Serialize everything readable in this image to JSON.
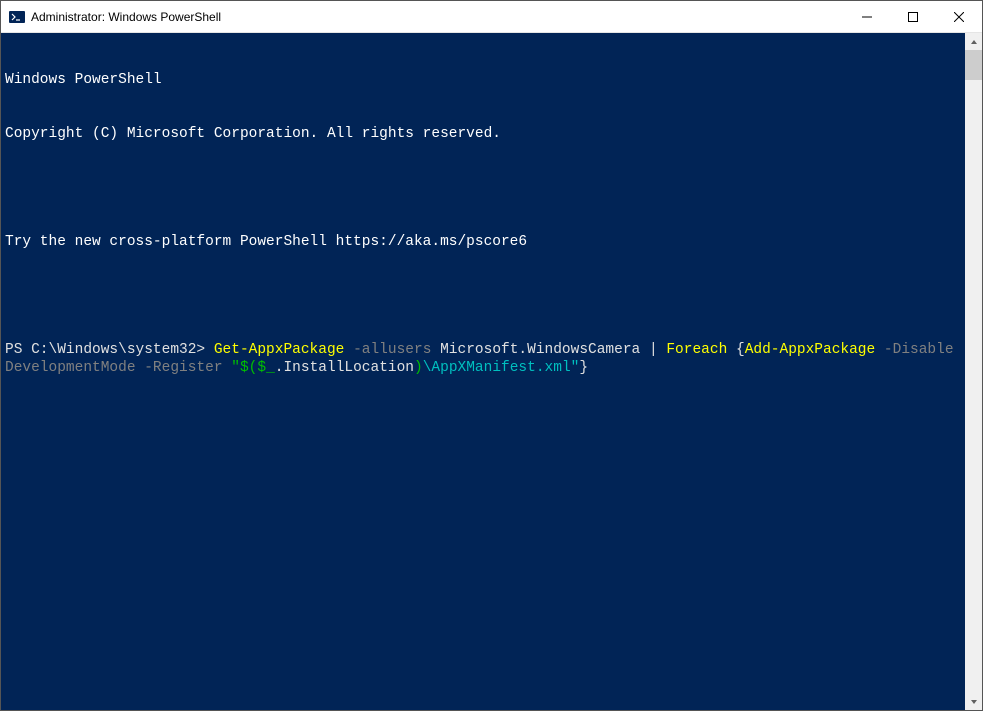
{
  "window": {
    "title": "Administrator: Windows PowerShell"
  },
  "console": {
    "banner_line1": "Windows PowerShell",
    "banner_line2": "Copyright (C) Microsoft Corporation. All rights reserved.",
    "hint": "Try the new cross-platform PowerShell https://aka.ms/pscore6",
    "prompt_prefix": "PS C:\\Windows\\system32> ",
    "command": {
      "tokens": [
        {
          "text": "Get-AppxPackage",
          "type": "cmd"
        },
        {
          "text": " ",
          "type": "white"
        },
        {
          "text": "-allusers",
          "type": "param"
        },
        {
          "text": " Microsoft.WindowsCamera ",
          "type": "white"
        },
        {
          "text": "|",
          "type": "white"
        },
        {
          "text": " ",
          "type": "white"
        },
        {
          "text": "Foreach",
          "type": "cmd"
        },
        {
          "text": " {",
          "type": "white"
        },
        {
          "text": "Add-AppxPackage",
          "type": "cmd"
        },
        {
          "text": " ",
          "type": "white"
        },
        {
          "text": "-DisableDevelopmentMode",
          "type": "param"
        },
        {
          "text": " ",
          "type": "white"
        },
        {
          "text": "-Register",
          "type": "param"
        },
        {
          "text": " ",
          "type": "white"
        },
        {
          "text": "\"$(",
          "type": "str"
        },
        {
          "text": "$_",
          "type": "str"
        },
        {
          "text": ".InstallLocation",
          "type": "white"
        },
        {
          "text": ")",
          "type": "str"
        },
        {
          "text": "\\AppXManifest.xml\"",
          "type": "str-esc"
        },
        {
          "text": "}",
          "type": "white"
        }
      ]
    }
  },
  "colors": {
    "console_bg": "#012456",
    "cmd": "#ffff00",
    "param": "#808080",
    "string": "#00bf00",
    "string_esc": "#00bfbf"
  }
}
